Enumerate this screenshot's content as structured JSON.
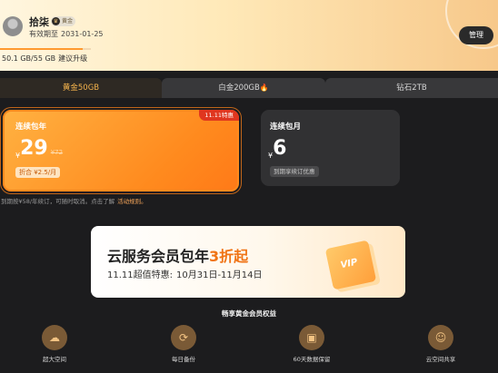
{
  "profile": {
    "username": "拾柒",
    "badge": "黄金",
    "expiry_label": "有效期至",
    "expiry_date": "2031-01-25",
    "storage": "50.1 GB/55 GB",
    "storage_tip": "建议升级",
    "storage_fraction": 0.91,
    "manage_label": "管理"
  },
  "tabs": [
    {
      "label": "黄金50GB",
      "active": true
    },
    {
      "label": "白金200GB",
      "active": false
    },
    {
      "label": "钻石2TB",
      "active": false
    }
  ],
  "plans": {
    "yearly": {
      "title": "连续包年",
      "currency": "¥",
      "price": "29",
      "original_price": "¥72",
      "per_month": "折合 ¥2.5/月",
      "promo_tag": "11.11特惠"
    },
    "monthly": {
      "title": "连续包月",
      "currency": "¥",
      "price": "6",
      "note": "到期享续订优惠"
    }
  },
  "renew_note": "到期按¥58/年续订，可随时取消。点击了解",
  "renew_link": "活动规则。",
  "banner": {
    "title_main": "云服务会员包年",
    "title_highlight": "3折起",
    "sub_label": "11.11超值特惠:",
    "sub_range": "10月31日-11月14日",
    "vip_text": "VIP"
  },
  "benefits": {
    "title": "畅享黄金会员权益",
    "items": [
      {
        "label": "超大空间",
        "icon": "cloud-storage-icon"
      },
      {
        "label": "每日备份",
        "icon": "backup-icon"
      },
      {
        "label": "60天数据保留",
        "icon": "trash-restore-icon"
      },
      {
        "label": "云空间共享",
        "icon": "user-share-icon"
      }
    ]
  },
  "colors": {
    "accent": "#ff8a1e",
    "highlight": "#f07314",
    "background": "#1c1c1e"
  }
}
